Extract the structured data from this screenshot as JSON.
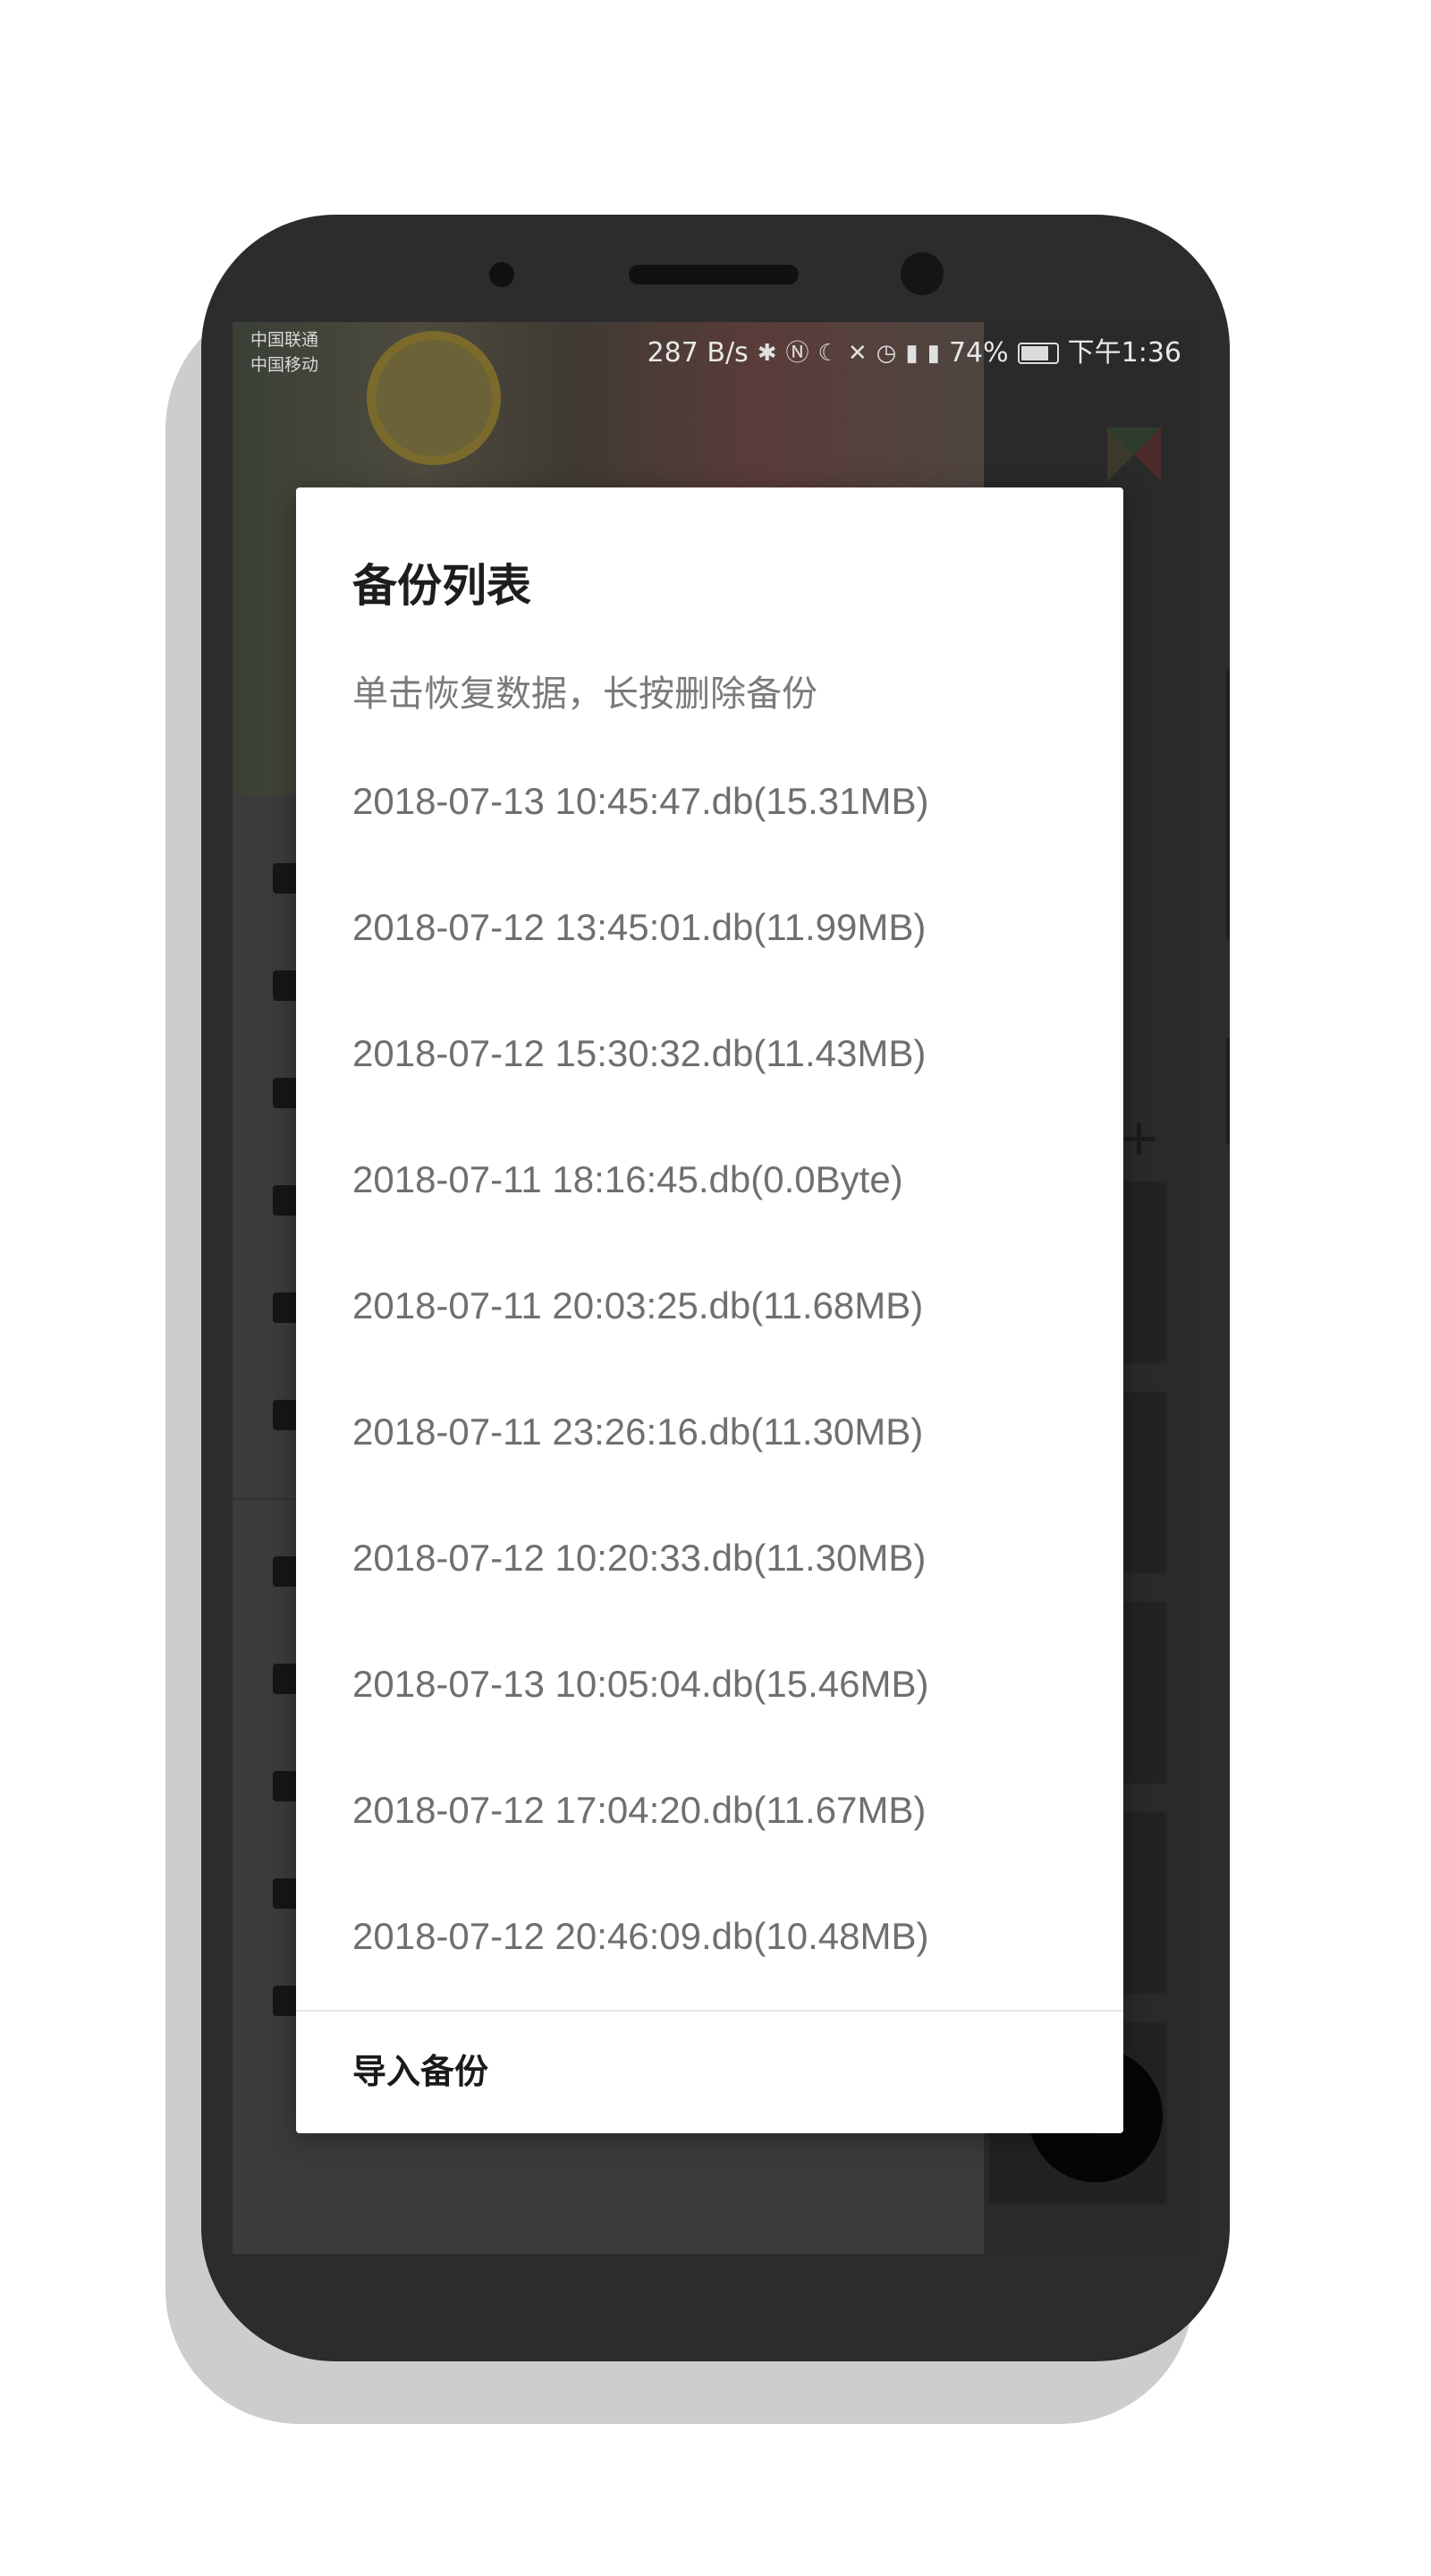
{
  "status_bar": {
    "carrier_1": "中国联通",
    "carrier_2": "中国移动",
    "net_speed": "287 B/s",
    "icons": [
      "bluetooth-icon",
      "nfc-icon",
      "moon-icon",
      "mute-icon",
      "alarm-icon",
      "signal-4g-icon",
      "signal-2g-icon"
    ],
    "battery_pct": "74%",
    "time": "下午1:36"
  },
  "dialog": {
    "title": "备份列表",
    "subtitle": "单击恢复数据，长按删除备份",
    "items": [
      "2018-07-13 10:45:47.db(15.31MB)",
      "2018-07-12 13:45:01.db(11.99MB)",
      "2018-07-12 15:30:32.db(11.43MB)",
      "2018-07-11 18:16:45.db(0.0Byte)",
      "2018-07-11 20:03:25.db(11.68MB)",
      "2018-07-11 23:26:16.db(11.30MB)",
      "2018-07-12 10:20:33.db(11.30MB)",
      "2018-07-13 10:05:04.db(15.46MB)",
      "2018-07-12 17:04:20.db(11.67MB)",
      "2018-07-12 20:46:09.db(10.48MB)"
    ],
    "import_label": "导入备份"
  },
  "colors": {
    "phone_body": "#2c2c2c",
    "dialog_bg": "#ffffff",
    "item_text": "#6f6f6f",
    "title_text": "#1d1d1d"
  }
}
